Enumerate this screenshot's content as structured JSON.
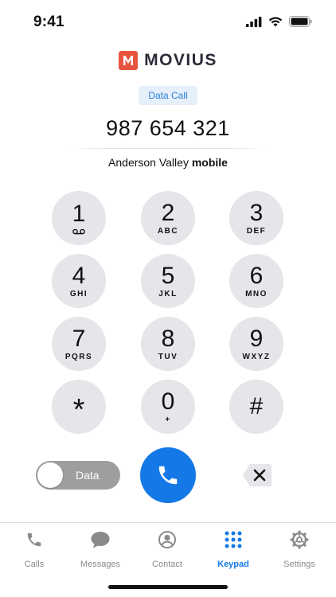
{
  "status_bar": {
    "time": "9:41"
  },
  "brand": {
    "name": "MOVIUS",
    "logo_letter": "M"
  },
  "call_mode_badge": "Data Call",
  "dialed_number": "987 654 321",
  "contact": {
    "name": "Anderson Valley",
    "type": "mobile"
  },
  "keypad": [
    {
      "digit": "1",
      "letters": ""
    },
    {
      "digit": "2",
      "letters": "ABC"
    },
    {
      "digit": "3",
      "letters": "DEF"
    },
    {
      "digit": "4",
      "letters": "GHI"
    },
    {
      "digit": "5",
      "letters": "JKL"
    },
    {
      "digit": "6",
      "letters": "MNO"
    },
    {
      "digit": "7",
      "letters": "PQRS"
    },
    {
      "digit": "8",
      "letters": "TUV"
    },
    {
      "digit": "9",
      "letters": "WXYZ"
    },
    {
      "digit": "*",
      "letters": ""
    },
    {
      "digit": "0",
      "letters": "+"
    },
    {
      "digit": "#",
      "letters": ""
    }
  ],
  "data_toggle": {
    "label": "Data",
    "on": false
  },
  "tabs": [
    {
      "label": "Calls",
      "icon": "phone-icon",
      "active": false
    },
    {
      "label": "Messages",
      "icon": "speech-bubble-icon",
      "active": false
    },
    {
      "label": "Contact",
      "icon": "person-circle-icon",
      "active": false
    },
    {
      "label": "Keypad",
      "icon": "dialpad-icon",
      "active": true
    },
    {
      "label": "Settings",
      "icon": "gear-icon",
      "active": false
    }
  ],
  "colors": {
    "accent": "#1479e6",
    "brand": "#e8553f",
    "key_background": "#e5e5ea",
    "toggle_off": "#9e9e9e",
    "badge_background": "#e6f0fb"
  }
}
